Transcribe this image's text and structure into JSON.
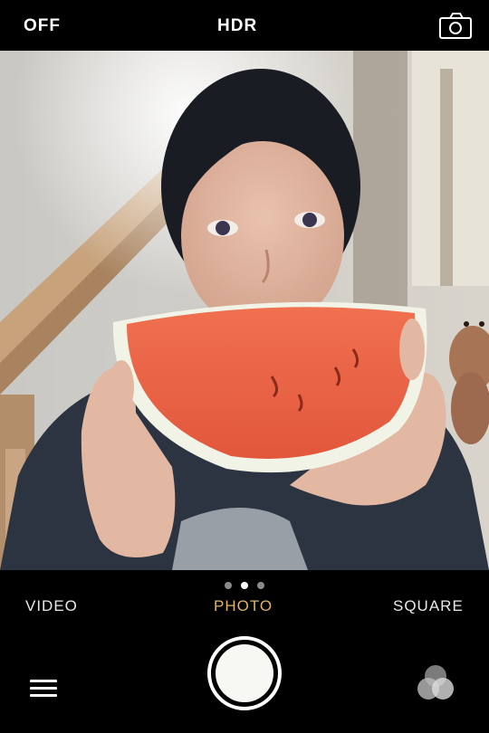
{
  "topbar": {
    "flash_label": "OFF",
    "hdr_label": "HDR",
    "flip_icon": "camera-flip-icon"
  },
  "modes": {
    "items": [
      "VIDEO",
      "PHOTO",
      "SQUARE"
    ],
    "selected": "PHOTO",
    "selected_color": "#e0b366",
    "page_dots_total": 3,
    "page_dot_active": 2
  },
  "controls": {
    "shutter_icon": "shutter-button",
    "menu_icon": "hamburger-menu-icon",
    "filters_icon": "filters-icon"
  },
  "viewfinder": {
    "subject": "photo-preview"
  }
}
